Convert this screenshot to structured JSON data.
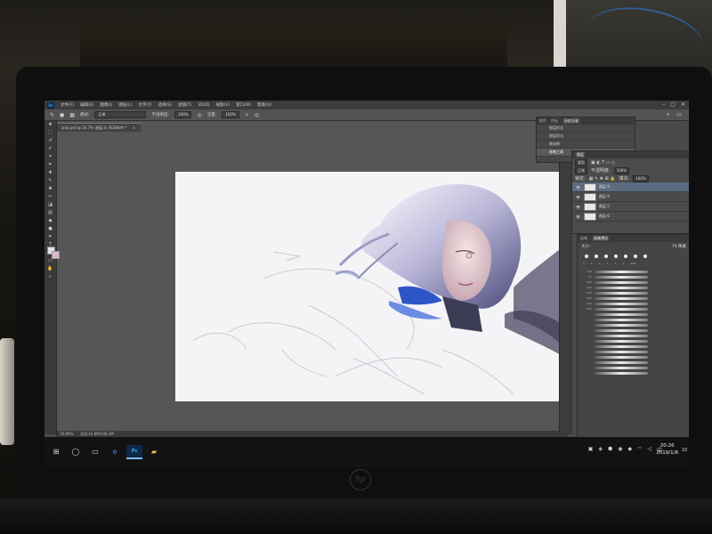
{
  "app": {
    "logo": "Ps"
  },
  "menu": [
    "文件(F)",
    "编辑(E)",
    "图像(I)",
    "图层(L)",
    "文字(Y)",
    "选择(S)",
    "滤镜(T)",
    "3D(D)",
    "视图(V)",
    "窗口(W)",
    "帮助(H)"
  ],
  "options": {
    "mode_label": "模式:",
    "mode_value": "正常",
    "opacity_label": "不透明度:",
    "opacity_value": "100%",
    "flow_label": "流量:",
    "flow_value": "100%"
  },
  "document": {
    "tab_label": "janji.psd @ 16.7% (图层 8, RGB/8#) *",
    "status_zoom": "16.69%",
    "status_doc": "文档:43.8M/248.3M"
  },
  "panels": {
    "top_tabs": [
      "颜色",
      "色板",
      "历史记录"
    ],
    "history_items": [
      "图层样式",
      "图层样式",
      "橡皮擦",
      "画笔工具"
    ],
    "layers_tabs": [
      "图层"
    ],
    "layers_kind": "类型",
    "layers_mode": "正常",
    "layers_opacity_label": "不透明度:",
    "layers_opacity_value": "100%",
    "layers_lock_label": "锁定:",
    "layers_fill_label": "填充:",
    "layers_fill_value": "100%",
    "layer_names": [
      "图层 8",
      "图层 9",
      "图层 5",
      "图层 6"
    ],
    "brush_tabs": [
      "画笔",
      "画笔预设"
    ],
    "brush_size_label": "大小:",
    "brush_size_value": "70 像素",
    "brush_preset_sizes": [
      "",
      "1",
      "1",
      "1",
      "1",
      "1",
      "1",
      "250"
    ],
    "brush_stroke_sizes": [
      "",
      "",
      "100",
      "50",
      "200",
      "100",
      "300",
      "500",
      "200",
      "300",
      "",
      "",
      "",
      "",
      "",
      "",
      "",
      "",
      "",
      ""
    ]
  },
  "taskbar": {
    "time": "20:26",
    "date": "2019/1/8",
    "notif_count": "10"
  }
}
